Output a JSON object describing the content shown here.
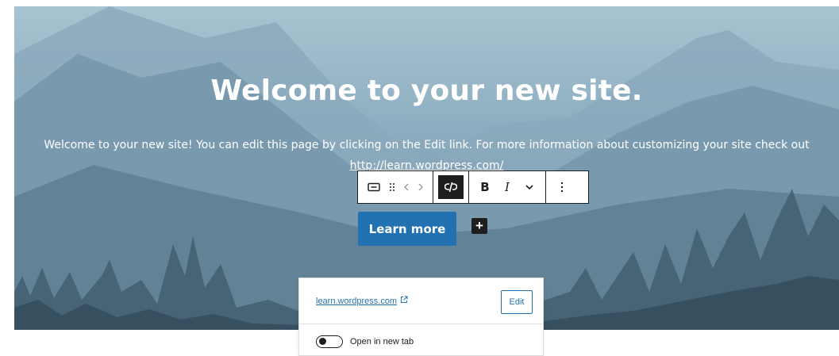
{
  "hero": {
    "title": "Welcome to your new site.",
    "body_text": "Welcome to your new site! You can edit this page by clicking on the Edit link. For more information about customizing your site check out",
    "body_link": "http://learn.wordpress.com/"
  },
  "toolbar": {
    "items": [
      "button-block-icon",
      "drag-handle-icon",
      "chevron-left-icon",
      "chevron-right-icon",
      "unlink-icon",
      "bold-icon",
      "italic-icon",
      "chevron-down-icon",
      "more-options-icon"
    ],
    "bold_label": "B",
    "italic_label": "I"
  },
  "button": {
    "label": "Learn more"
  },
  "add_block": {
    "label": "+"
  },
  "link_popover": {
    "link_text": "learn.wordpress.com",
    "edit_label": "Edit",
    "toggle_label": "Open in new tab",
    "toggle_on": false
  },
  "colors": {
    "accent": "#2271b1",
    "toolbar_dark": "#1e1e1e",
    "hero_sky": "#a8c3d1"
  }
}
